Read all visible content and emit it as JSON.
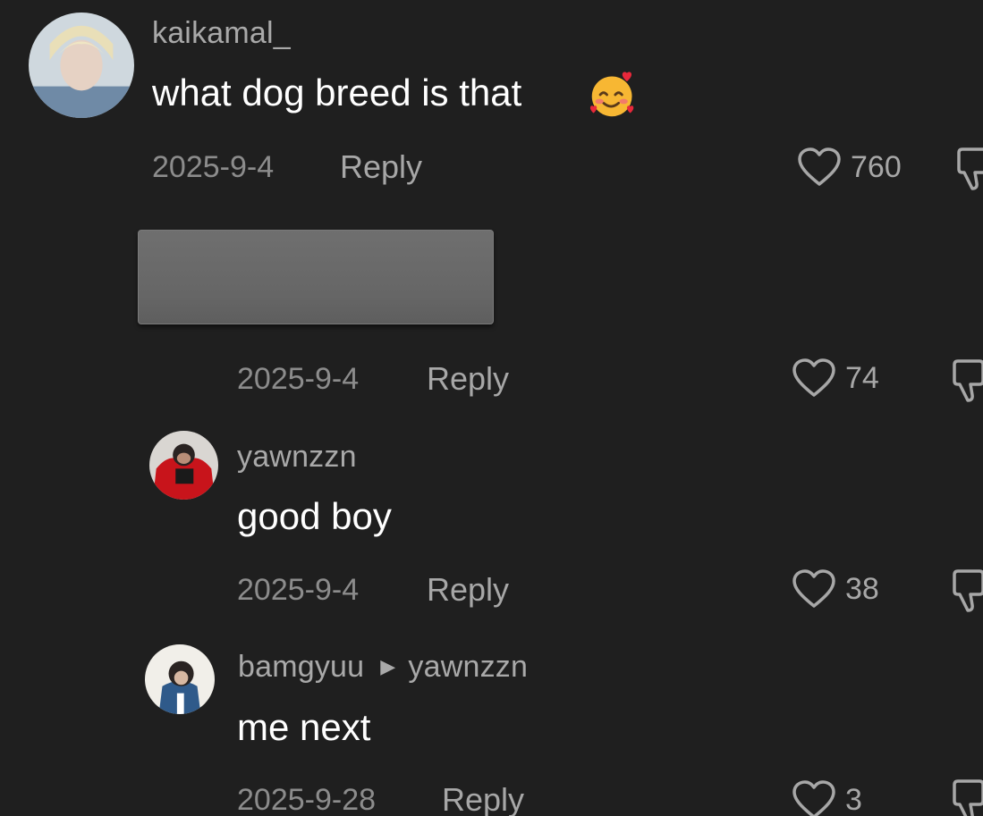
{
  "comments": [
    {
      "username": "kaikamal_",
      "text": "what dog breed is that",
      "emoji": "smiling-face-with-hearts",
      "date": "2025-9-4",
      "reply_label": "Reply",
      "likes": "760"
    },
    {
      "username": "",
      "text": "",
      "redacted": true,
      "date": "2025-9-4",
      "reply_label": "Reply",
      "likes": "74"
    },
    {
      "username": "yawnzzn",
      "text": "good boy",
      "date": "2025-9-4",
      "reply_label": "Reply",
      "likes": "38"
    },
    {
      "username": "bamgyuu",
      "reply_to": "yawnzzn",
      "text": "me next",
      "date": "2025-9-28",
      "reply_label": "Reply",
      "likes": "3"
    }
  ],
  "icons": {
    "like": "heart-outline-icon",
    "dislike": "thumbs-down-icon",
    "reply_to": "triangle-right-icon"
  },
  "colors": {
    "background": "#1f1f1f",
    "username": "#a9a9a9",
    "text": "#ffffff",
    "meta": "#8c8c8c",
    "redaction": "#6a6a6a"
  }
}
